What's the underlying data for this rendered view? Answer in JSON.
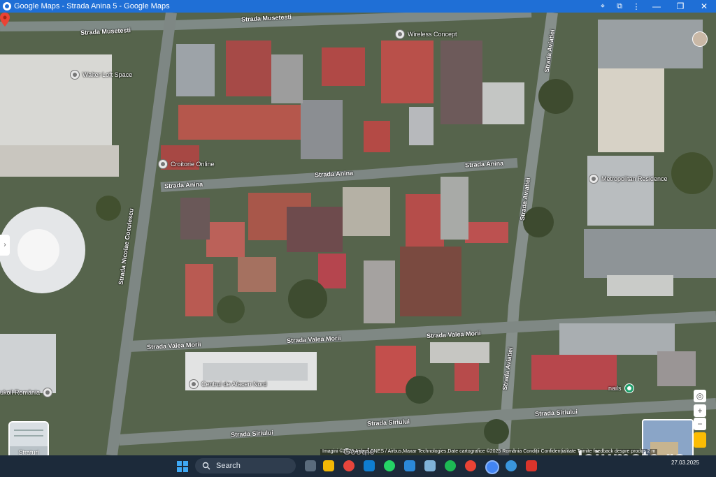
{
  "window": {
    "title": "Google Maps - Strada Anina 5 - Google Maps"
  },
  "streets": [
    {
      "id": "musetesti-1",
      "label": "Strada Musetesti"
    },
    {
      "id": "musetesti-2",
      "label": "Strada Musetesti"
    },
    {
      "id": "anina-1",
      "label": "Strada Anina"
    },
    {
      "id": "anina-2",
      "label": "Strada Anina"
    },
    {
      "id": "anina-3",
      "label": "Strada Anina"
    },
    {
      "id": "nicolae-coculescu",
      "label": "Strada Nicolae Coculescu"
    },
    {
      "id": "aviatiei-1",
      "label": "Strada Aviatiei"
    },
    {
      "id": "aviatiei-2",
      "label": "Strada Aviatiei"
    },
    {
      "id": "aviatiei-3",
      "label": "Strada Aviatiei"
    },
    {
      "id": "valea-morii-1",
      "label": "Strada Valea Morii"
    },
    {
      "id": "valea-morii-2",
      "label": "Strada Valea Morii"
    },
    {
      "id": "valea-morii-3",
      "label": "Strada Valea Morii"
    },
    {
      "id": "siriului-1",
      "label": "Strada Siriului"
    },
    {
      "id": "siriului-2",
      "label": "Strada Siriului"
    },
    {
      "id": "siriului-3",
      "label": "Strada Siriului"
    }
  ],
  "pois": [
    {
      "label": "Wireless Concept",
      "icon": "place-icon"
    },
    {
      "label": "Walter Loft Space",
      "icon": "place-icon"
    },
    {
      "label": "Croitorie Online",
      "icon": "place-icon"
    },
    {
      "label": "Metropolitan Residence",
      "icon": "place-icon"
    },
    {
      "label": "Centrul de Afaceri Nord",
      "icon": "place-icon"
    },
    {
      "label": "ukoil România",
      "icon": "place-icon"
    },
    {
      "label": "nails",
      "icon": "nails-icon"
    }
  ],
  "controls": {
    "layers_label": "Straturi",
    "zoom_in": "+",
    "zoom_out": "−"
  },
  "footer": {
    "google_logo": "Google",
    "attribution": "Imagini ©2025 Airbus,CNES / Airbus,Maxar Technologies,Date cartografice ©2025   România   Condiții   Confidențialitate   Trimite feedback despre produs   2 m"
  },
  "taskbar": {
    "search_placeholder": "Search",
    "date": "27.03.2025"
  },
  "watermark": "lajumate.ro",
  "colors": {
    "titlebar": "#1f6fd6",
    "taskbar": "#1c2a3a",
    "pin": "#ea4335"
  }
}
